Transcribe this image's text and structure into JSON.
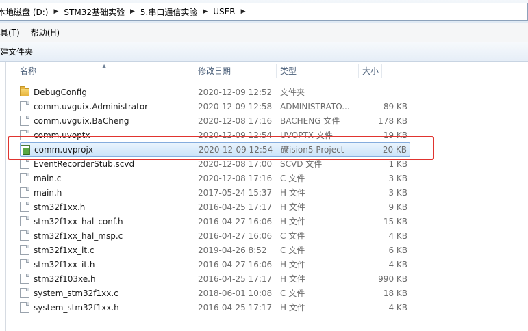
{
  "breadcrumb": [
    {
      "label": "本地磁盘 (D:)"
    },
    {
      "label": "STM32基础实验"
    },
    {
      "label": "5.串口通信实验"
    },
    {
      "label": "USER"
    }
  ],
  "menu": {
    "tools": "工具(T)",
    "help": "帮助(H)"
  },
  "toolbar": {
    "new_folder": "新建文件夹"
  },
  "columns": {
    "name": "名称",
    "date": "修改日期",
    "type": "类型",
    "size": "大小"
  },
  "files": [
    {
      "name": "DebugConfig",
      "date": "2020-12-09 12:52",
      "type": "文件夹",
      "size": "",
      "icon": "folder-icon"
    },
    {
      "name": "comm.uvguix.Administrator",
      "date": "2020-12-09 12:58",
      "type": "ADMINISTRATO...",
      "size": "89 KB",
      "icon": "file-icon"
    },
    {
      "name": "comm.uvguix.BaCheng",
      "date": "2020-12-08 17:16",
      "type": "BACHENG 文件",
      "size": "178 KB",
      "icon": "file-icon"
    },
    {
      "name": "comm.uvoptx",
      "date": "2020-12-09 12:54",
      "type": "UVOPTX 文件",
      "size": "19 KB",
      "icon": "file-icon"
    },
    {
      "name": "comm.uvprojx",
      "date": "2020-12-09 12:54",
      "type": "礦ision5 Project",
      "size": "20 KB",
      "icon": "uvision-project-icon",
      "selected": true
    },
    {
      "name": "EventRecorderStub.scvd",
      "date": "2020-12-08 17:00",
      "type": "SCVD 文件",
      "size": "1 KB",
      "icon": "file-icon"
    },
    {
      "name": "main.c",
      "date": "2020-12-08 17:16",
      "type": "C 文件",
      "size": "3 KB",
      "icon": "file-icon"
    },
    {
      "name": "main.h",
      "date": "2017-05-24 15:37",
      "type": "H 文件",
      "size": "3 KB",
      "icon": "file-icon"
    },
    {
      "name": "stm32f1xx.h",
      "date": "2016-04-25 17:17",
      "type": "H 文件",
      "size": "9 KB",
      "icon": "file-icon"
    },
    {
      "name": "stm32f1xx_hal_conf.h",
      "date": "2016-04-27 16:06",
      "type": "H 文件",
      "size": "15 KB",
      "icon": "file-icon"
    },
    {
      "name": "stm32f1xx_hal_msp.c",
      "date": "2016-04-27 16:06",
      "type": "C 文件",
      "size": "4 KB",
      "icon": "file-icon"
    },
    {
      "name": "stm32f1xx_it.c",
      "date": "2019-04-26 8:52",
      "type": "C 文件",
      "size": "6 KB",
      "icon": "file-icon"
    },
    {
      "name": "stm32f1xx_it.h",
      "date": "2016-04-27 16:06",
      "type": "H 文件",
      "size": "4 KB",
      "icon": "file-icon"
    },
    {
      "name": "stm32f103xe.h",
      "date": "2016-04-25 17:17",
      "type": "H 文件",
      "size": "990 KB",
      "icon": "file-icon"
    },
    {
      "name": "system_stm32f1xx.c",
      "date": "2018-06-01 10:08",
      "type": "C 文件",
      "size": "18 KB",
      "icon": "file-icon"
    },
    {
      "name": "system_stm32f1xx.h",
      "date": "2016-04-25 17:17",
      "type": "H 文件",
      "size": "4 KB",
      "icon": "file-icon"
    }
  ],
  "colors": {
    "highlight_border": "#e0342f",
    "selection_fill": "#cce4f9"
  }
}
